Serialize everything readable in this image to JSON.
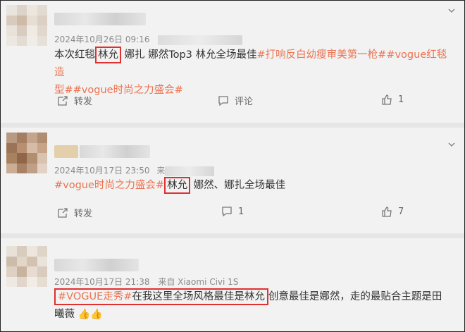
{
  "posts": [
    {
      "time": "2024年10月26日 09:16",
      "text_prefix": "本次红毯",
      "highlight": "林允",
      "text_mid": "娜扎 娜然Top3 林允全场最佳",
      "tags_line1": "#打响反白幼瘦审美第一枪##vogue红毯造",
      "tags_line2": "型##vogue时尚之力盛会#",
      "repost_label": "转发",
      "comment_label": "评论",
      "like_count": "1"
    },
    {
      "time": "2024年10月17日 23:50",
      "source_prefix": "来",
      "tag": "#vogue时尚之力盛会#",
      "highlight": "林允",
      "text_after": "娜然、娜扎全场最佳",
      "repost_label": "转发",
      "comment_count": "1",
      "like_count": "7"
    },
    {
      "time": "2024年10月17日 21:38",
      "source": "来自 Xiaomi Civi 1S",
      "tag": "#VOGUE走秀#",
      "highlight_text": "在我这里全场风格最佳是林允",
      "text_after": "创意最佳是娜然，走的最贴合主题是田",
      "text_line2": "曦薇",
      "emoji": "👍👍"
    }
  ],
  "colors": {
    "tag": "#eb7350",
    "highlight_border": "#e03030",
    "background": "#f2f2f2"
  },
  "icons": [
    "chevron-down-icon",
    "repost-icon",
    "comment-icon",
    "like-icon",
    "thumbs-up-emoji"
  ]
}
